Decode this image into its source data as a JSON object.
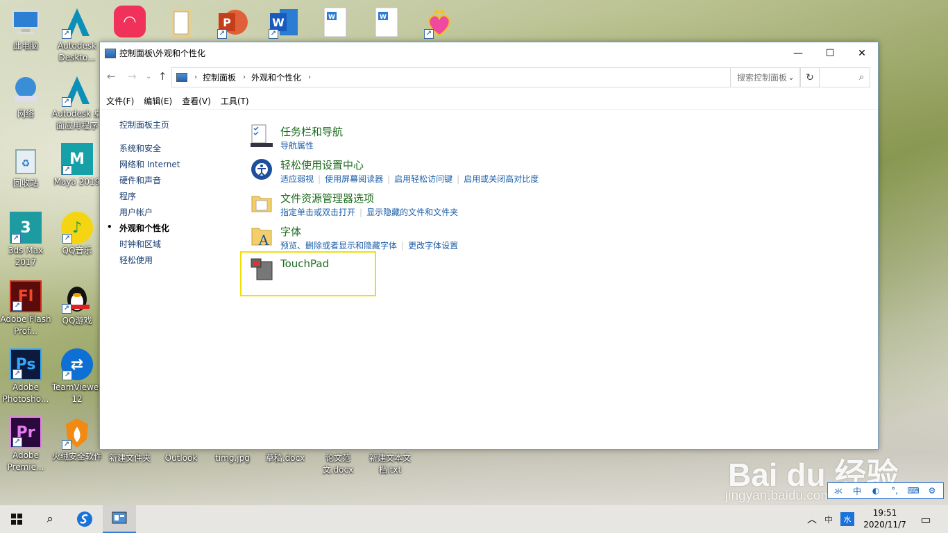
{
  "desktop": {
    "icons": [
      {
        "name": "此电脑",
        "id": "this-pc"
      },
      {
        "name": "Autodesk Deskto...",
        "id": "autodesk-desktop"
      },
      {
        "name": "网络",
        "id": "network"
      },
      {
        "name": "Autodesk 桌面应用程序",
        "id": "autodesk-app"
      },
      {
        "name": "回收站",
        "id": "recycle-bin"
      },
      {
        "name": "Maya 2019",
        "id": "maya"
      },
      {
        "name": "3ds Max 2017",
        "id": "3dsmax"
      },
      {
        "name": "QQ音乐",
        "id": "qqmusic"
      },
      {
        "name": "Adobe Flash Prof...",
        "id": "flash"
      },
      {
        "name": "QQ游戏",
        "id": "qqgame"
      },
      {
        "name": "Adobe Photosho...",
        "id": "photoshop"
      },
      {
        "name": "TeamViewer 12",
        "id": "teamviewer"
      },
      {
        "name": "Adobe Premie...",
        "id": "premiere"
      },
      {
        "name": "火绒安全软件",
        "id": "huorong"
      },
      {
        "name": "新建文件夹",
        "id": "new-folder"
      },
      {
        "name": "Outlook",
        "id": "outlook"
      },
      {
        "name": "timg.jpg",
        "id": "timg"
      },
      {
        "name": "草稿.docx",
        "id": "draft"
      },
      {
        "name": "论文范文.docx",
        "id": "paper"
      },
      {
        "name": "新建文本文档.txt",
        "id": "newtxt"
      }
    ]
  },
  "window": {
    "title": "控制面板\\外观和个性化",
    "breadcrumb": [
      "控制面板",
      "外观和个性化"
    ],
    "search_placeholder": "搜索控制面板",
    "menu": [
      "文件(F)",
      "编辑(E)",
      "查看(V)",
      "工具(T)"
    ],
    "left_nav": {
      "home": "控制面板主页",
      "items": [
        "系统和安全",
        "网络和 Internet",
        "硬件和声音",
        "程序",
        "用户帐户",
        "外观和个性化",
        "时钟和区域",
        "轻松使用"
      ],
      "current": "外观和个性化"
    },
    "categories": [
      {
        "title": "任务栏和导航",
        "links": [
          "导航属性"
        ],
        "icon": "taskbar-icon"
      },
      {
        "title": "轻松使用设置中心",
        "links": [
          "适应弱视",
          "使用屏幕阅读器",
          "启用轻松访问键",
          "启用或关闭高对比度"
        ],
        "icon": "ease-of-access-icon"
      },
      {
        "title": "文件资源管理器选项",
        "links": [
          "指定单击或双击打开",
          "显示隐藏的文件和文件夹"
        ],
        "icon": "folder-options-icon"
      },
      {
        "title": "字体",
        "links": [
          "预览、删除或者显示和隐藏字体",
          "更改字体设置"
        ],
        "icon": "fonts-icon"
      },
      {
        "title": "TouchPad",
        "links": [],
        "icon": "touchpad-icon"
      }
    ]
  },
  "taskbar": {
    "time": "19:51",
    "date": "2020/11/7",
    "ime_lang": "中",
    "ime_mode": "水"
  },
  "imebar": [
    "氺",
    "中",
    "◐",
    "°,",
    "⌨",
    "⚙"
  ],
  "watermark": {
    "brand": "Bai du 经验",
    "url": "jingyan.baidu.com"
  }
}
